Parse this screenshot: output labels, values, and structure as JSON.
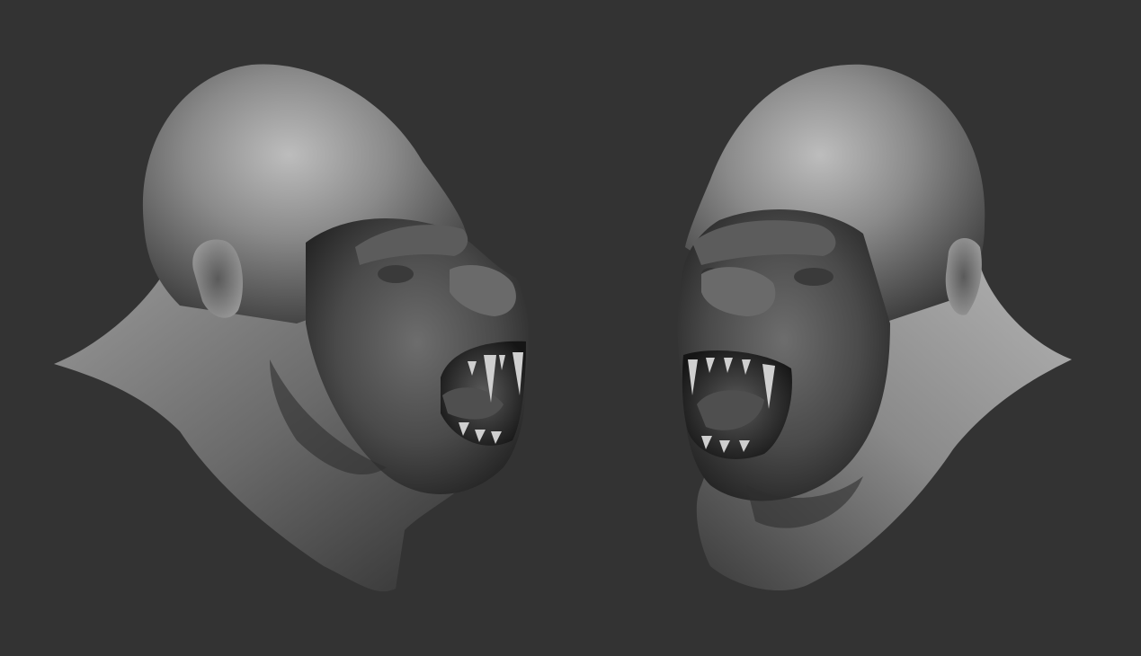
{
  "scene": {
    "background_color": "#333333",
    "subject": "gorilla-head-sculpt",
    "views": [
      {
        "id": "left-view",
        "facing": "right"
      },
      {
        "id": "right-view",
        "facing": "left"
      }
    ],
    "colors": {
      "clay_light": "#b9b9b9",
      "clay_mid": "#7a7a7a",
      "clay_dark": "#2b2b2b",
      "mouth_dark": "#1e1e1e",
      "tooth": "#d2d2d2"
    }
  }
}
